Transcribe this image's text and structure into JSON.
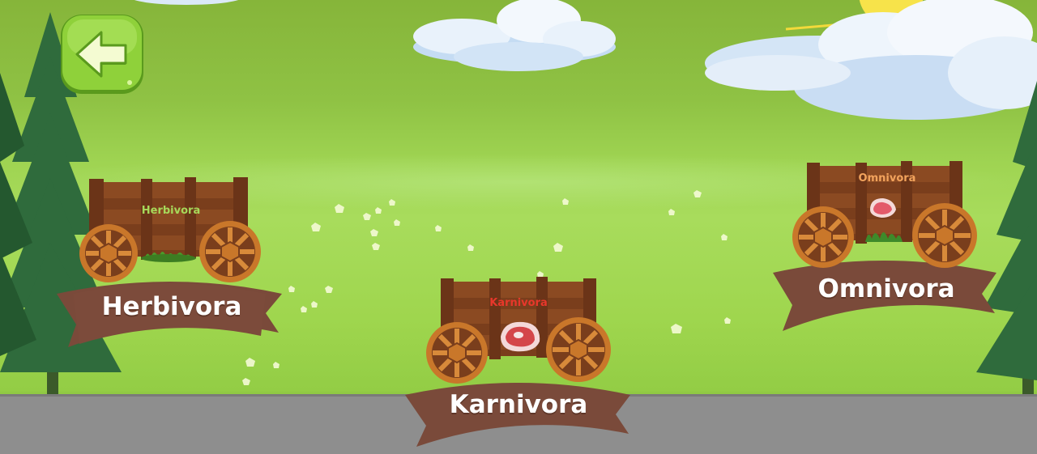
{
  "nav": {
    "back_icon": "arrow-left-icon"
  },
  "carts": [
    {
      "id": "herbivora",
      "sign": "Herbivora",
      "label": "Herbivora",
      "sign_color": "#a6d85a",
      "icon": "grass-icon"
    },
    {
      "id": "karnivora",
      "sign": "Karnivora",
      "label": "Karnivora",
      "sign_color": "#e8372b",
      "icon": "steak-icon"
    },
    {
      "id": "omnivora",
      "sign": "Omnivora",
      "label": "Omnivora",
      "sign_color": "#f2a35c",
      "icon": "steak-and-grass-icon"
    }
  ],
  "colors": {
    "wood": "#7a3e1c",
    "banner": "#7a4a3a",
    "button": "#8fd13a"
  }
}
